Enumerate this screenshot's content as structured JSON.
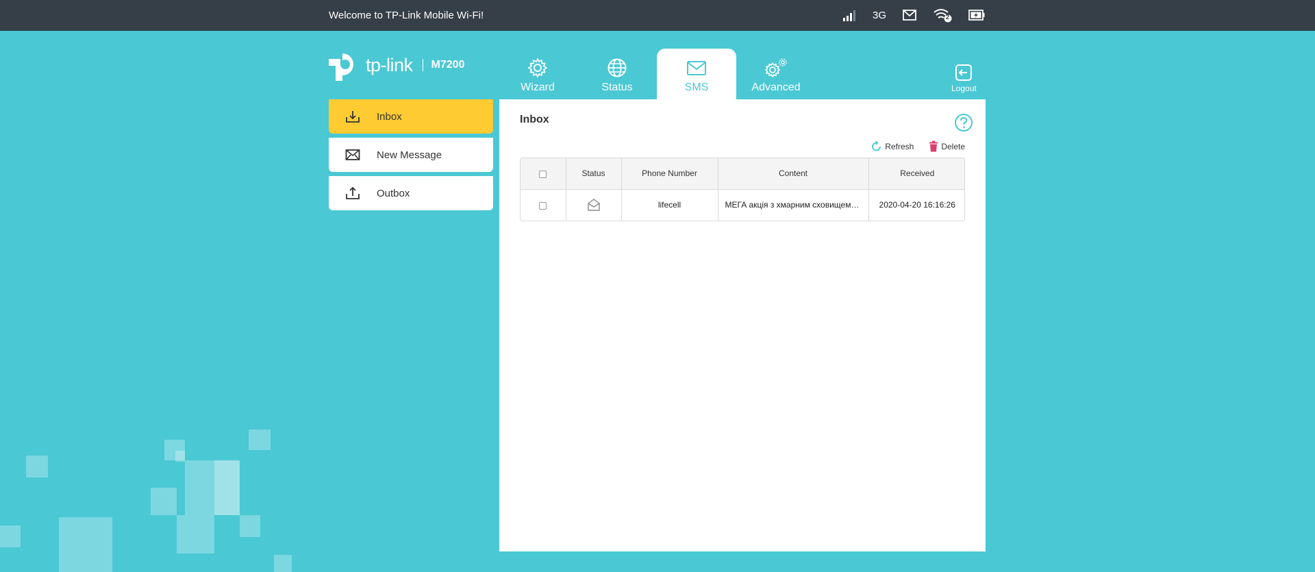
{
  "topbar": {
    "welcome": "Welcome to TP-Link Mobile Wi-Fi!",
    "network_type": "3G",
    "wifi_clients": "2"
  },
  "header": {
    "brand": "tp-link",
    "model": "M7200",
    "logout_label": "Logout"
  },
  "nav": {
    "tabs": [
      {
        "label": "Wizard"
      },
      {
        "label": "Status"
      },
      {
        "label": "SMS"
      },
      {
        "label": "Advanced"
      }
    ],
    "active": "SMS"
  },
  "sidebar": {
    "items": [
      {
        "label": "Inbox"
      },
      {
        "label": "New Message"
      },
      {
        "label": "Outbox"
      }
    ],
    "active": "Inbox"
  },
  "panel": {
    "title": "Inbox",
    "refresh_label": "Refresh",
    "delete_label": "Delete"
  },
  "table": {
    "columns": [
      "Status",
      "Phone Number",
      "Content",
      "Received"
    ],
    "rows": [
      {
        "phone": "lifecell",
        "content": "МЕГА акція з хмарним сховищем…",
        "received": "2020-04-20 16:16:26"
      }
    ]
  },
  "colors": {
    "background": "#4ac8d4",
    "topbar": "#363f48",
    "accent": "#ffcb33",
    "delete": "#d9406a"
  }
}
